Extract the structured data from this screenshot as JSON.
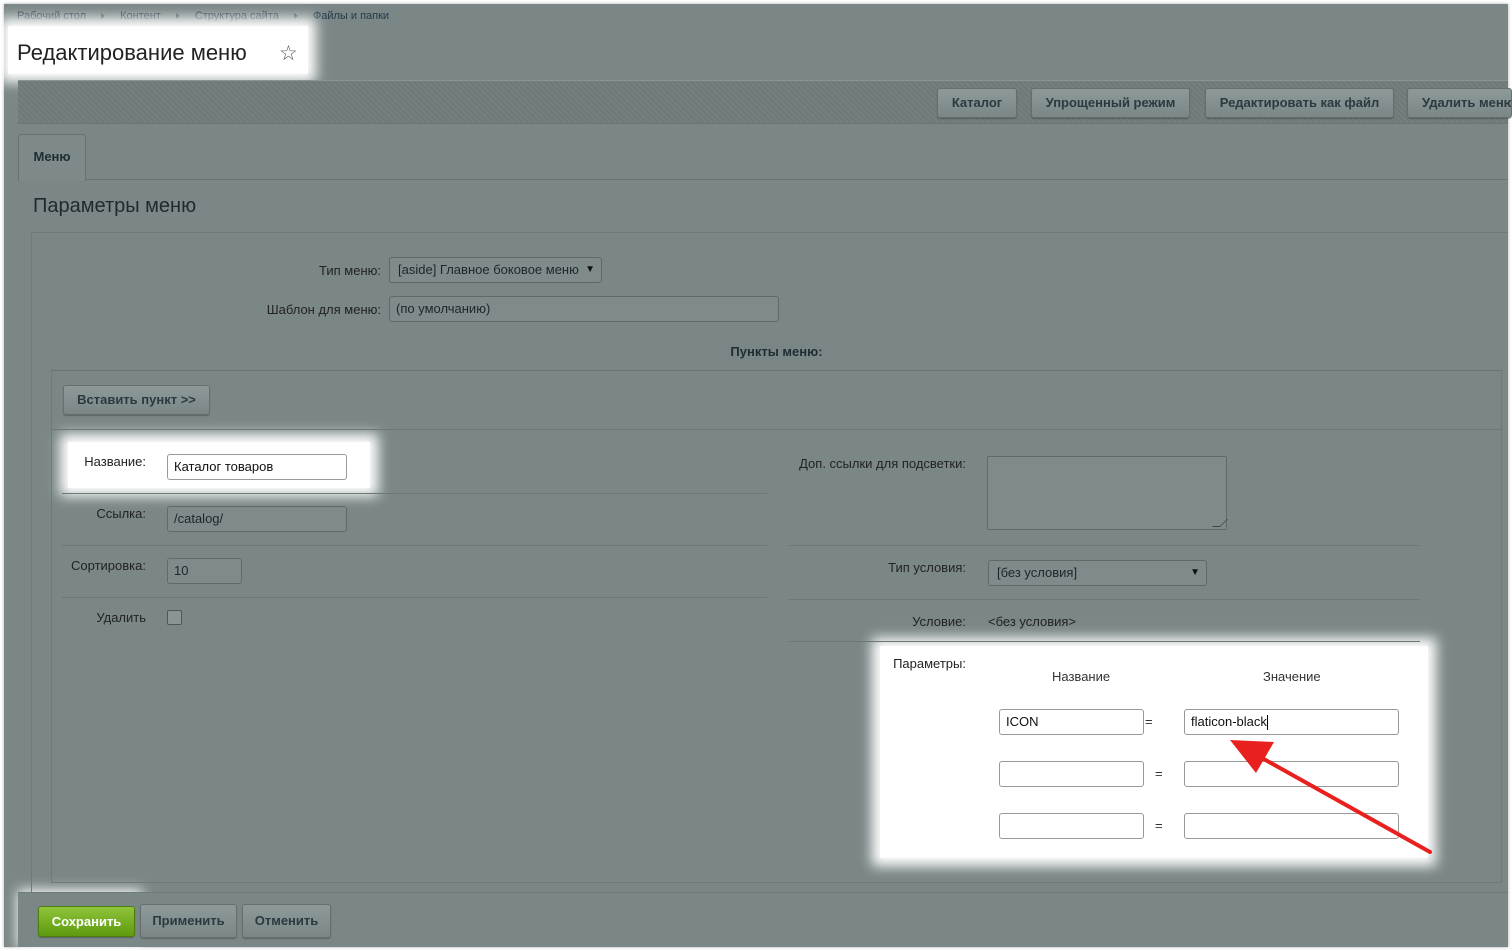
{
  "breadcrumb": [
    "Рабочий стол",
    "Контент",
    "Структура сайта",
    "Файлы и папки"
  ],
  "page_title": "Редактирование меню",
  "toolbar": {
    "catalog": "Каталог",
    "simple_mode": "Упрощенный режим",
    "edit_as_file": "Редактировать как файл",
    "delete": "Удалить меню"
  },
  "tabs": [
    {
      "label": "Меню"
    }
  ],
  "section_title": "Параметры меню",
  "menu_type": {
    "label": "Тип меню:",
    "value": "[aside] Главное боковое меню"
  },
  "template": {
    "label": "Шаблон для меню:",
    "value": "(по умолчанию)"
  },
  "items": {
    "header": "Пункты меню:",
    "insert_button": "Вставить пункт >>",
    "name": {
      "label": "Название:",
      "value": "Каталог товаров"
    },
    "link": {
      "label": "Ссылка:",
      "value": "/catalog/"
    },
    "sort": {
      "label": "Сортировка:",
      "value": "10"
    },
    "delete_label": "Удалить",
    "extra_links_label": "Доп. ссылки для подсветки:",
    "condition_type": {
      "label": "Тип условия:",
      "value": "[без условия]"
    },
    "condition": {
      "label": "Условие:",
      "value": "<без условия>"
    },
    "params": {
      "label": "Параметры:",
      "col_name": "Название",
      "col_value": "Значение",
      "eq": "=",
      "rows": [
        {
          "name": "ICON",
          "value": "flaticon-black"
        },
        {
          "name": "",
          "value": ""
        },
        {
          "name": "",
          "value": ""
        }
      ]
    }
  },
  "footer": {
    "save": "Сохранить",
    "apply": "Применить",
    "cancel": "Отменить"
  },
  "colors": {
    "save_green": "#6aa81a",
    "annotation_arrow": "#e8201e"
  }
}
